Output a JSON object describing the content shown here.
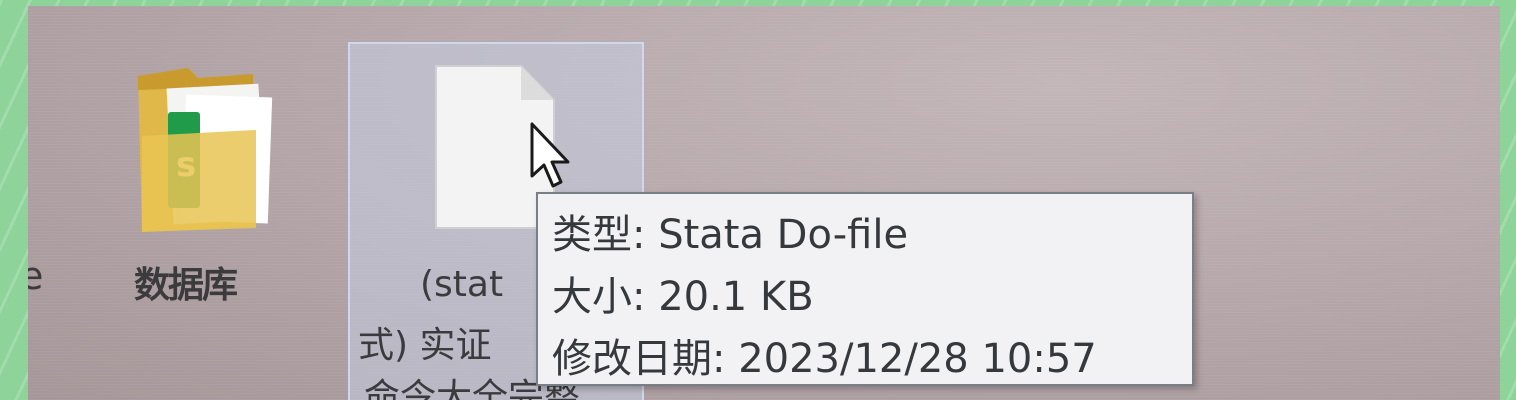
{
  "desktop": {
    "items": [
      {
        "label_fragment": "e",
        "icon": "partial-file-icon"
      },
      {
        "label": "数据库",
        "icon": "folder-with-spreadsheet-icon"
      },
      {
        "label_lines": [
          "(stat",
          "式) 实证",
          "命令大全完整"
        ],
        "icon": "blank-document-icon",
        "selected": true
      }
    ]
  },
  "tooltip": {
    "type_row": "类型: Stata Do-file",
    "size_row": "大小: 20.1 KB",
    "date_row": "修改日期: 2023/12/28 10:57"
  },
  "cursor": {
    "icon": "mouse-pointer-icon"
  },
  "colors": {
    "frame": "#8ed39a",
    "desktop": "#b6a8ab",
    "selection": "#c4cee2",
    "tooltip_bg": "#f2f2f4",
    "tooltip_border": "#7a7e86",
    "text": "#35383d"
  }
}
